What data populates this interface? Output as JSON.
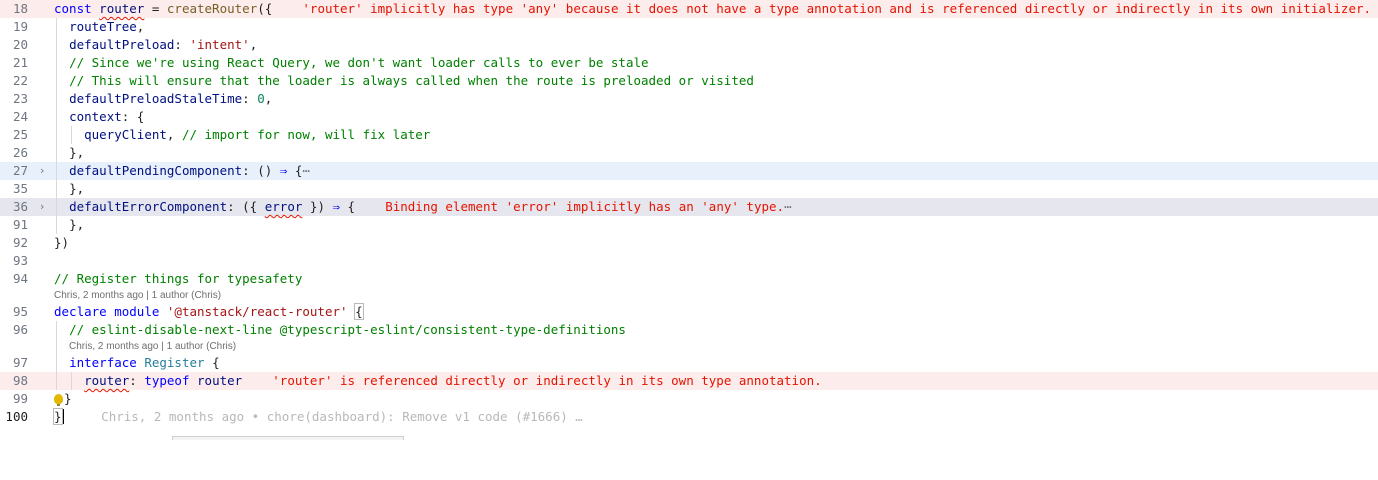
{
  "lines": {
    "l18": {
      "num": "18",
      "k1": "const",
      "v1": "router",
      "p1": " = ",
      "f1": "createRouter",
      "p2": "({",
      "err": "'router' implicitly has type 'any' because it does not have a type annotation and is referenced directly or indirectly in its own initializer."
    },
    "l19": {
      "num": "19",
      "v1": "routeTree",
      "p1": ","
    },
    "l20": {
      "num": "20",
      "v1": "defaultPreload",
      "p1": ": ",
      "s1": "'intent'",
      "p2": ","
    },
    "l21": {
      "num": "21",
      "c1": "// Since we're using React Query, we don't want loader calls to ever be stale"
    },
    "l22": {
      "num": "22",
      "c1": "// This will ensure that the loader is always called when the route is preloaded or visited"
    },
    "l23": {
      "num": "23",
      "v1": "defaultPreloadStaleTime",
      "p1": ": ",
      "n1": "0",
      "p2": ","
    },
    "l24": {
      "num": "24",
      "v1": "context",
      "p1": ": {"
    },
    "l25": {
      "num": "25",
      "v1": "queryClient",
      "p1": ", ",
      "c1": "// import for now, will fix later"
    },
    "l26": {
      "num": "26",
      "p1": "},"
    },
    "l27": {
      "num": "27",
      "v1": "defaultPendingComponent",
      "p1": ": () ",
      "k1": "⇒",
      "p2": " {",
      "collapsed": "⋯"
    },
    "l35": {
      "num": "35",
      "p1": "},"
    },
    "l36": {
      "num": "36",
      "v1": "defaultErrorComponent",
      "p1": ": ({ ",
      "v2": "error",
      "p2": " }) ",
      "k1": "⇒",
      "p3": " {",
      "err": "Binding element 'error' implicitly has an 'any' type.",
      "collapsed": "⋯"
    },
    "l92": {
      "num": "92",
      "p1": "},"
    },
    "l91": {
      "num": "91",
      "p1": "})"
    },
    "l93": {
      "num": "93"
    },
    "l94": {
      "num": "94",
      "c1": "// Register things for typesafety"
    },
    "lens1": "Chris, 2 months ago | 1 author (Chris)",
    "l95": {
      "num": "95",
      "k1": "declare",
      "k2": "module",
      "s1": "'@tanstack/react-router'",
      "p1": "{"
    },
    "l96": {
      "num": "96",
      "c1": "// eslint-disable-next-line @typescript-eslint/consistent-type-definitions"
    },
    "lens2": "Chris, 2 months ago | 1 author (Chris)",
    "l97": {
      "num": "97",
      "k1": "interface",
      "t1": "Register",
      "p1": " {"
    },
    "l98": {
      "num": "98",
      "v1": "router",
      "p1": ": ",
      "k1": "typeof",
      "v2": "router",
      "err": "'router' is referenced directly or indirectly in its own type annotation."
    },
    "l99": {
      "num": "99",
      "p1": "}"
    },
    "l100": {
      "num": "100",
      "p1": "}",
      "blame": "Chris, 2 months ago • chore(dashboard): Remove v1 code (#1666) …"
    }
  }
}
